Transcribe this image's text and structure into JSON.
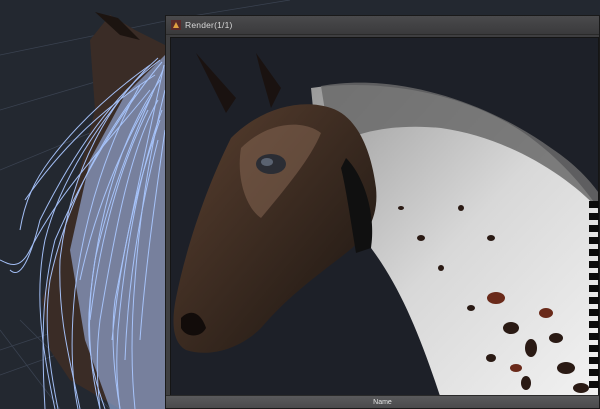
{
  "render_window": {
    "title": "Render(1/1)",
    "status_label": "Name"
  },
  "icons": {
    "app": "renderer-app-icon"
  },
  "colors": {
    "viewport_bg": "#232830",
    "hair_guides": "#a9c6ff",
    "window_chrome": "#3e3e40",
    "render_bg": "#1d2028"
  }
}
